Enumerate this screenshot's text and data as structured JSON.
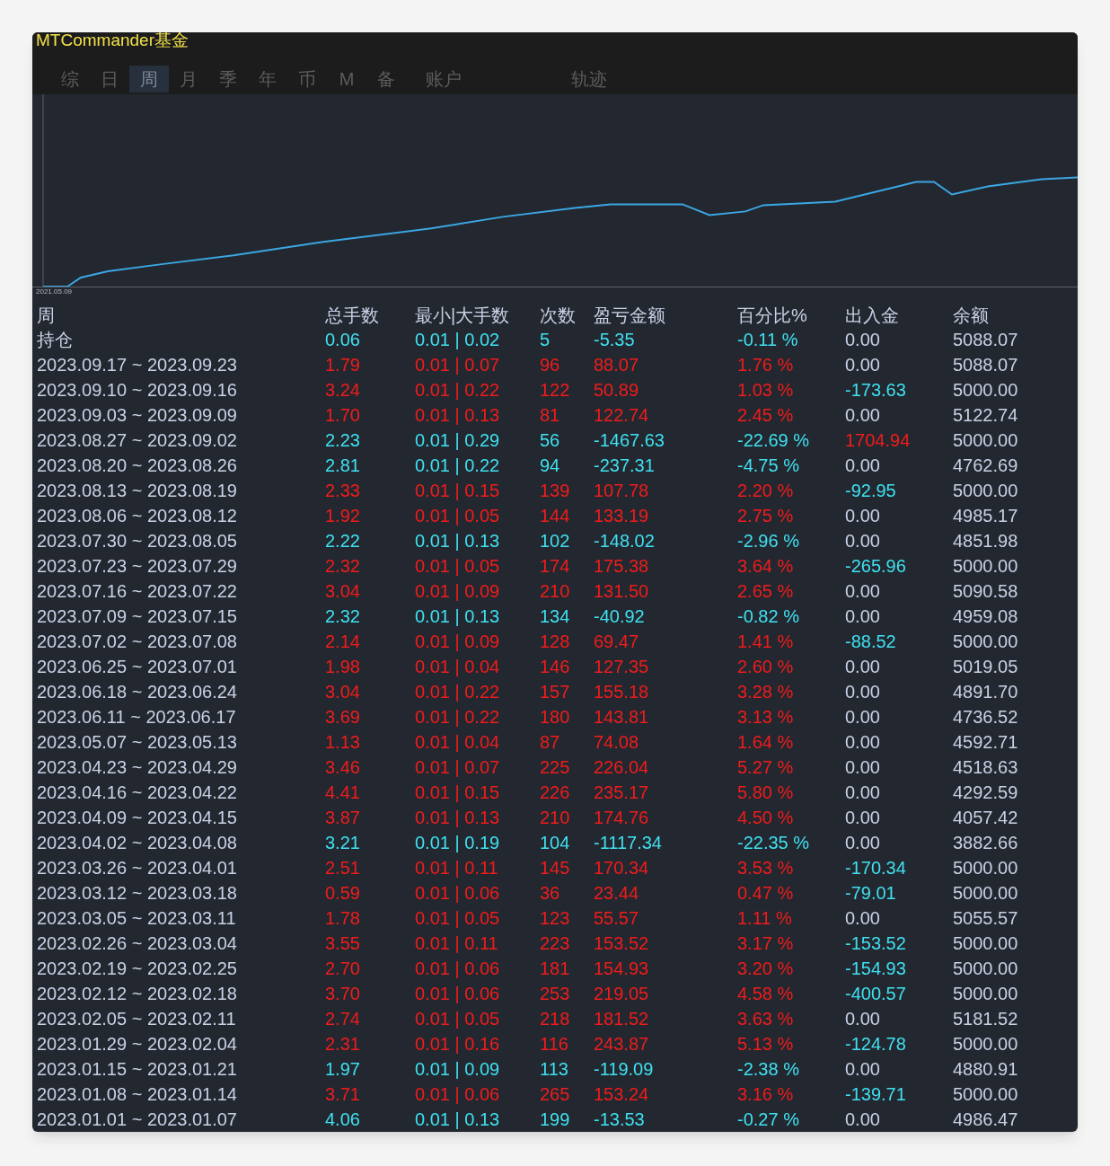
{
  "window": {
    "title": "MTCommander基金"
  },
  "tabs": [
    {
      "label": "综",
      "selected": false
    },
    {
      "label": "日",
      "selected": false
    },
    {
      "label": "周",
      "selected": true
    },
    {
      "label": "月",
      "selected": false
    },
    {
      "label": "季",
      "selected": false
    },
    {
      "label": "年",
      "selected": false
    },
    {
      "label": "币",
      "selected": false
    },
    {
      "label": "M",
      "selected": false
    },
    {
      "label": "备",
      "selected": false
    },
    {
      "label": "账户",
      "selected": false
    },
    {
      "label": "轨迹",
      "selected": false
    }
  ],
  "chart": {
    "start_label": "2021.05.09"
  },
  "table": {
    "columns": [
      "周",
      "总手数",
      "最小|大手数",
      "次数",
      "盈亏金额",
      "百分比%",
      "出入金",
      "余额"
    ],
    "rows": [
      {
        "cells": [
          "持仓",
          "0.06",
          "0.01 | 0.02",
          "5",
          "-5.35",
          "-0.11 %"
        ],
        "color": "#3fe0f0",
        "flow": {
          "text": "0.00",
          "color": "#c9d1e6"
        },
        "balance": "5088.07"
      },
      {
        "cells": [
          "2023.09.17 ~ 2023.09.23",
          "1.79",
          "0.01 | 0.07",
          "96",
          "88.07",
          "1.76 %"
        ],
        "color": "#f01c1c",
        "flow": {
          "text": "0.00",
          "color": "#c9d1e6"
        },
        "balance": "5088.07"
      },
      {
        "cells": [
          "2023.09.10 ~ 2023.09.16",
          "3.24",
          "0.01 | 0.22",
          "122",
          "50.89",
          "1.03 %"
        ],
        "color": "#f01c1c",
        "flow": {
          "text": "-173.63",
          "color": "#3fe0f0"
        },
        "balance": "5000.00"
      },
      {
        "cells": [
          "2023.09.03 ~ 2023.09.09",
          "1.70",
          "0.01 | 0.13",
          "81",
          "122.74",
          "2.45 %"
        ],
        "color": "#f01c1c",
        "flow": {
          "text": "0.00",
          "color": "#c9d1e6"
        },
        "balance": "5122.74"
      },
      {
        "cells": [
          "2023.08.27 ~ 2023.09.02",
          "2.23",
          "0.01 | 0.29",
          "56",
          "-1467.63",
          "-22.69 %"
        ],
        "color": "#3fe0f0",
        "flow": {
          "text": "1704.94",
          "color": "#f01c1c"
        },
        "balance": "5000.00"
      },
      {
        "cells": [
          "2023.08.20 ~ 2023.08.26",
          "2.81",
          "0.01 | 0.22",
          "94",
          "-237.31",
          "-4.75 %"
        ],
        "color": "#3fe0f0",
        "flow": {
          "text": "0.00",
          "color": "#c9d1e6"
        },
        "balance": "4762.69"
      },
      {
        "cells": [
          "2023.08.13 ~ 2023.08.19",
          "2.33",
          "0.01 | 0.15",
          "139",
          "107.78",
          "2.20 %"
        ],
        "color": "#f01c1c",
        "flow": {
          "text": "-92.95",
          "color": "#3fe0f0"
        },
        "balance": "5000.00"
      },
      {
        "cells": [
          "2023.08.06 ~ 2023.08.12",
          "1.92",
          "0.01 | 0.05",
          "144",
          "133.19",
          "2.75 %"
        ],
        "color": "#f01c1c",
        "flow": {
          "text": "0.00",
          "color": "#c9d1e6"
        },
        "balance": "4985.17"
      },
      {
        "cells": [
          "2023.07.30 ~ 2023.08.05",
          "2.22",
          "0.01 | 0.13",
          "102",
          "-148.02",
          "-2.96 %"
        ],
        "color": "#3fe0f0",
        "flow": {
          "text": "0.00",
          "color": "#c9d1e6"
        },
        "balance": "4851.98"
      },
      {
        "cells": [
          "2023.07.23 ~ 2023.07.29",
          "2.32",
          "0.01 | 0.05",
          "174",
          "175.38",
          "3.64 %"
        ],
        "color": "#f01c1c",
        "flow": {
          "text": "-265.96",
          "color": "#3fe0f0"
        },
        "balance": "5000.00"
      },
      {
        "cells": [
          "2023.07.16 ~ 2023.07.22",
          "3.04",
          "0.01 | 0.09",
          "210",
          "131.50",
          "2.65 %"
        ],
        "color": "#f01c1c",
        "flow": {
          "text": "0.00",
          "color": "#c9d1e6"
        },
        "balance": "5090.58"
      },
      {
        "cells": [
          "2023.07.09 ~ 2023.07.15",
          "2.32",
          "0.01 | 0.13",
          "134",
          "-40.92",
          "-0.82 %"
        ],
        "color": "#3fe0f0",
        "flow": {
          "text": "0.00",
          "color": "#c9d1e6"
        },
        "balance": "4959.08"
      },
      {
        "cells": [
          "2023.07.02 ~ 2023.07.08",
          "2.14",
          "0.01 | 0.09",
          "128",
          "69.47",
          "1.41 %"
        ],
        "color": "#f01c1c",
        "flow": {
          "text": "-88.52",
          "color": "#3fe0f0"
        },
        "balance": "5000.00"
      },
      {
        "cells": [
          "2023.06.25 ~ 2023.07.01",
          "1.98",
          "0.01 | 0.04",
          "146",
          "127.35",
          "2.60 %"
        ],
        "color": "#f01c1c",
        "flow": {
          "text": "0.00",
          "color": "#c9d1e6"
        },
        "balance": "5019.05"
      },
      {
        "cells": [
          "2023.06.18 ~ 2023.06.24",
          "3.04",
          "0.01 | 0.22",
          "157",
          "155.18",
          "3.28 %"
        ],
        "color": "#f01c1c",
        "flow": {
          "text": "0.00",
          "color": "#c9d1e6"
        },
        "balance": "4891.70"
      },
      {
        "cells": [
          "2023.06.11 ~ 2023.06.17",
          "3.69",
          "0.01 | 0.22",
          "180",
          "143.81",
          "3.13 %"
        ],
        "color": "#f01c1c",
        "flow": {
          "text": "0.00",
          "color": "#c9d1e6"
        },
        "balance": "4736.52"
      },
      {
        "cells": [
          "2023.05.07 ~ 2023.05.13",
          "1.13",
          "0.01 | 0.04",
          "87",
          "74.08",
          "1.64 %"
        ],
        "color": "#f01c1c",
        "flow": {
          "text": "0.00",
          "color": "#c9d1e6"
        },
        "balance": "4592.71"
      },
      {
        "cells": [
          "2023.04.23 ~ 2023.04.29",
          "3.46",
          "0.01 | 0.07",
          "225",
          "226.04",
          "5.27 %"
        ],
        "color": "#f01c1c",
        "flow": {
          "text": "0.00",
          "color": "#c9d1e6"
        },
        "balance": "4518.63"
      },
      {
        "cells": [
          "2023.04.16 ~ 2023.04.22",
          "4.41",
          "0.01 | 0.15",
          "226",
          "235.17",
          "5.80 %"
        ],
        "color": "#f01c1c",
        "flow": {
          "text": "0.00",
          "color": "#c9d1e6"
        },
        "balance": "4292.59"
      },
      {
        "cells": [
          "2023.04.09 ~ 2023.04.15",
          "3.87",
          "0.01 | 0.13",
          "210",
          "174.76",
          "4.50 %"
        ],
        "color": "#f01c1c",
        "flow": {
          "text": "0.00",
          "color": "#c9d1e6"
        },
        "balance": "4057.42"
      },
      {
        "cells": [
          "2023.04.02 ~ 2023.04.08",
          "3.21",
          "0.01 | 0.19",
          "104",
          "-1117.34",
          "-22.35 %"
        ],
        "color": "#3fe0f0",
        "flow": {
          "text": "0.00",
          "color": "#c9d1e6"
        },
        "balance": "3882.66"
      },
      {
        "cells": [
          "2023.03.26 ~ 2023.04.01",
          "2.51",
          "0.01 | 0.11",
          "145",
          "170.34",
          "3.53 %"
        ],
        "color": "#f01c1c",
        "flow": {
          "text": "-170.34",
          "color": "#3fe0f0"
        },
        "balance": "5000.00"
      },
      {
        "cells": [
          "2023.03.12 ~ 2023.03.18",
          "0.59",
          "0.01 | 0.06",
          "36",
          "23.44",
          "0.47 %"
        ],
        "color": "#f01c1c",
        "flow": {
          "text": "-79.01",
          "color": "#3fe0f0"
        },
        "balance": "5000.00"
      },
      {
        "cells": [
          "2023.03.05 ~ 2023.03.11",
          "1.78",
          "0.01 | 0.05",
          "123",
          "55.57",
          "1.11 %"
        ],
        "color": "#f01c1c",
        "flow": {
          "text": "0.00",
          "color": "#c9d1e6"
        },
        "balance": "5055.57"
      },
      {
        "cells": [
          "2023.02.26 ~ 2023.03.04",
          "3.55",
          "0.01 | 0.11",
          "223",
          "153.52",
          "3.17 %"
        ],
        "color": "#f01c1c",
        "flow": {
          "text": "-153.52",
          "color": "#3fe0f0"
        },
        "balance": "5000.00"
      },
      {
        "cells": [
          "2023.02.19 ~ 2023.02.25",
          "2.70",
          "0.01 | 0.06",
          "181",
          "154.93",
          "3.20 %"
        ],
        "color": "#f01c1c",
        "flow": {
          "text": "-154.93",
          "color": "#3fe0f0"
        },
        "balance": "5000.00"
      },
      {
        "cells": [
          "2023.02.12 ~ 2023.02.18",
          "3.70",
          "0.01 | 0.06",
          "253",
          "219.05",
          "4.58 %"
        ],
        "color": "#f01c1c",
        "flow": {
          "text": "-400.57",
          "color": "#3fe0f0"
        },
        "balance": "5000.00"
      },
      {
        "cells": [
          "2023.02.05 ~ 2023.02.11",
          "2.74",
          "0.01 | 0.05",
          "218",
          "181.52",
          "3.63 %"
        ],
        "color": "#f01c1c",
        "flow": {
          "text": "0.00",
          "color": "#c9d1e6"
        },
        "balance": "5181.52"
      },
      {
        "cells": [
          "2023.01.29 ~ 2023.02.04",
          "2.31",
          "0.01 | 0.16",
          "116",
          "243.87",
          "5.13 %"
        ],
        "color": "#f01c1c",
        "flow": {
          "text": "-124.78",
          "color": "#3fe0f0"
        },
        "balance": "5000.00"
      },
      {
        "cells": [
          "2023.01.15 ~ 2023.01.21",
          "1.97",
          "0.01 | 0.09",
          "113",
          "-119.09",
          "-2.38 %"
        ],
        "color": "#3fe0f0",
        "flow": {
          "text": "0.00",
          "color": "#c9d1e6"
        },
        "balance": "4880.91"
      },
      {
        "cells": [
          "2023.01.08 ~ 2023.01.14",
          "3.71",
          "0.01 | 0.06",
          "265",
          "153.24",
          "3.16 %"
        ],
        "color": "#f01c1c",
        "flow": {
          "text": "-139.71",
          "color": "#3fe0f0"
        },
        "balance": "5000.00"
      },
      {
        "cells": [
          "2023.01.01 ~ 2023.01.07",
          "4.06",
          "0.01 | 0.13",
          "199",
          "-13.53",
          "-0.27 %"
        ],
        "color": "#3fe0f0",
        "flow": {
          "text": "0.00",
          "color": "#c9d1e6"
        },
        "balance": "4986.47"
      }
    ]
  }
}
